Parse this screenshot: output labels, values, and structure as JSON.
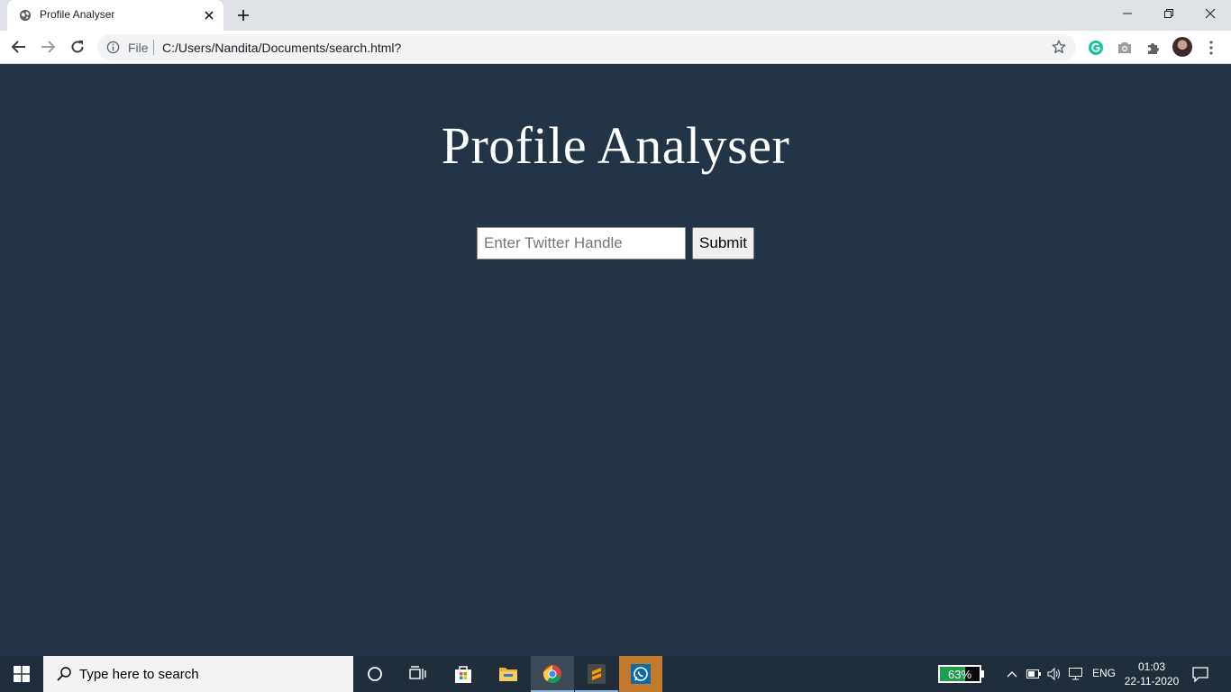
{
  "browser": {
    "tab": {
      "title": "Profile Analyser",
      "favicon": "globe-icon"
    },
    "address_bar": {
      "scheme": "File",
      "url": "C:/Users/Nandita/Documents/search.html?"
    },
    "extensions": [
      "grammarly-icon",
      "camera-icon",
      "puzzle-icon"
    ]
  },
  "page": {
    "title": "Profile Analyser",
    "search": {
      "placeholder": "Enter Twitter Handle",
      "value": ""
    },
    "submit_label": "Submit",
    "background_color": "#233447"
  },
  "taskbar": {
    "search_placeholder": "Type here to search",
    "apps": [
      "cortana-icon",
      "task-view-icon",
      "store-icon",
      "file-explorer-icon",
      "chrome-icon",
      "sublime-text-icon",
      "whatsapp-icon"
    ],
    "battery_percent": 63,
    "battery_label": "63%",
    "language": "ENG",
    "time": "01:03",
    "date": "22-11-2020"
  }
}
